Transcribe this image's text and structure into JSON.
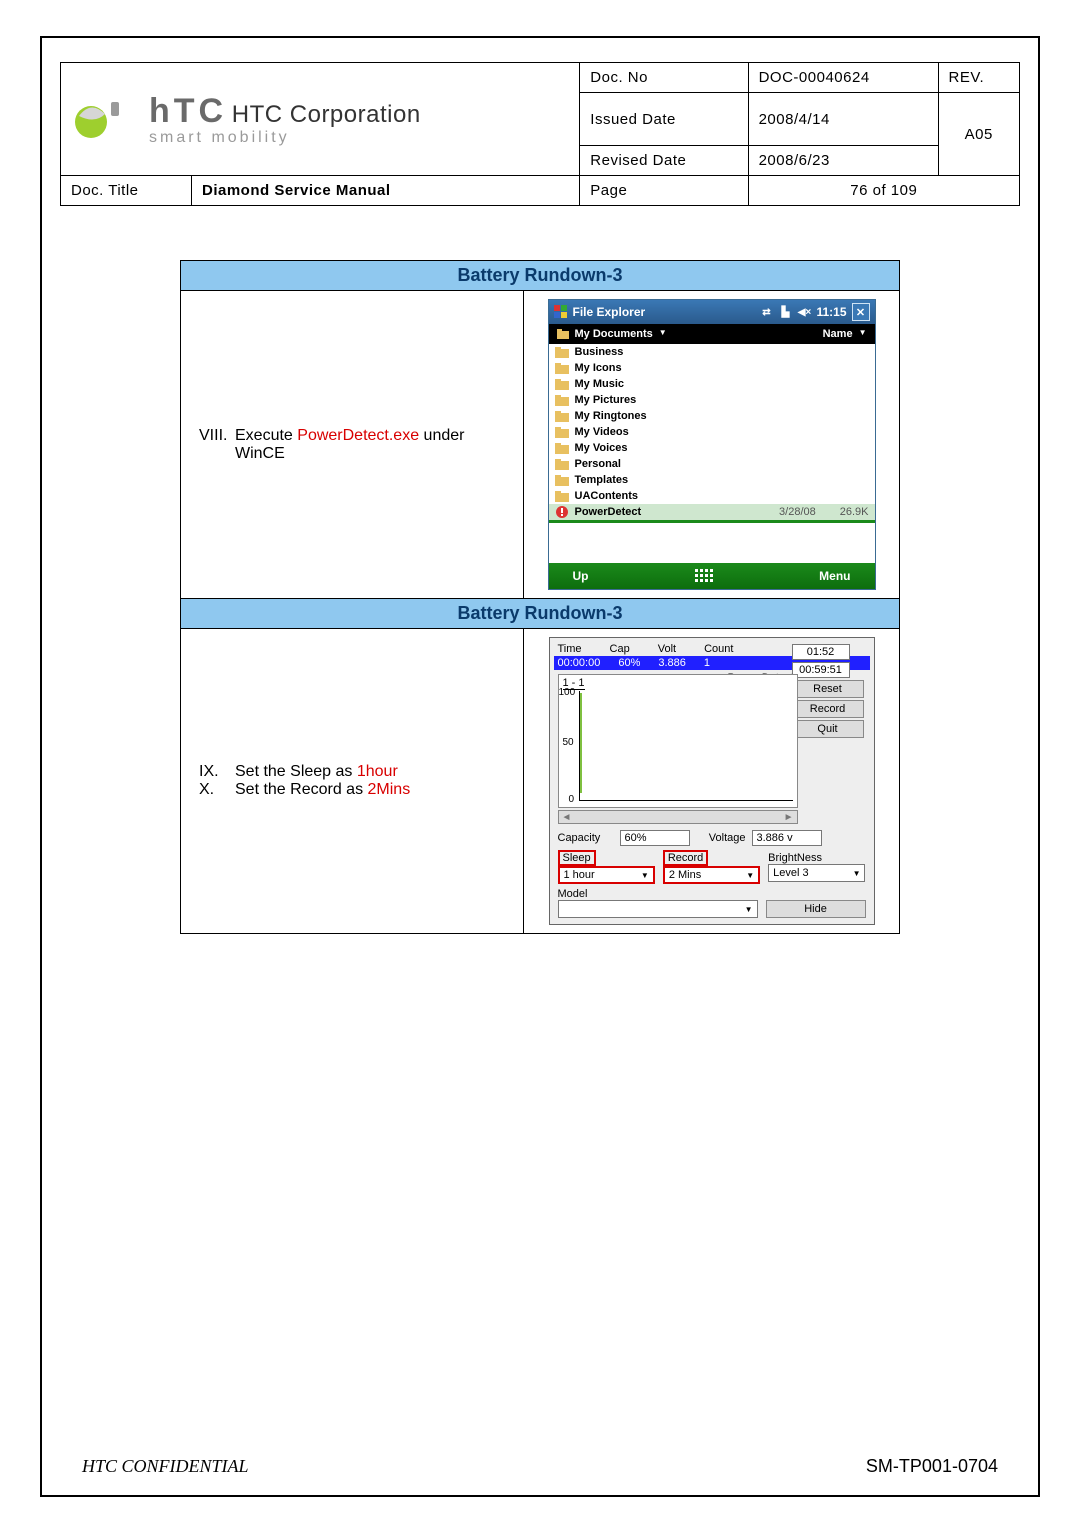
{
  "header": {
    "company": "HTC Corporation",
    "tagline": "smart mobility",
    "doc_no_label": "Doc. No",
    "doc_no": "DOC-00040624",
    "rev_label": "REV.",
    "rev": "A05",
    "issued_label": "Issued Date",
    "issued": "2008/4/14",
    "revised_label": "Revised Date",
    "revised": "2008/6/23",
    "doc_title_label": "Doc. Title",
    "doc_title": "Diamond Service Manual",
    "page_label": "Page",
    "page": "76  of  109"
  },
  "section1": {
    "title": "Battery Rundown-3",
    "instr_num": "VIII.",
    "instr_a": "Execute ",
    "instr_red": "PowerDetect.exe",
    "instr_b": " under",
    "instr_c": "WinCE"
  },
  "file_explorer": {
    "title": "File Explorer",
    "time": "11:15",
    "path": "My Documents",
    "sort": "Name",
    "items": [
      {
        "name": "Business",
        "type": "folder"
      },
      {
        "name": "My Icons",
        "type": "folder"
      },
      {
        "name": "My Music",
        "type": "folder"
      },
      {
        "name": "My Pictures",
        "type": "folder"
      },
      {
        "name": "My Ringtones",
        "type": "folder"
      },
      {
        "name": "My Videos",
        "type": "folder"
      },
      {
        "name": "My Voices",
        "type": "folder"
      },
      {
        "name": "Personal",
        "type": "folder"
      },
      {
        "name": "Templates",
        "type": "folder"
      },
      {
        "name": "UAContents",
        "type": "folder"
      }
    ],
    "selected": {
      "name": "PowerDetect",
      "date": "3/28/08",
      "size": "26.9K"
    },
    "btn_up": "Up",
    "btn_menu": "Menu"
  },
  "section2": {
    "title": "Battery Rundown-3",
    "line1_num": "IX.",
    "line1_a": "Set the Sleep as ",
    "line1_red": "1hour",
    "line2_num": "X.",
    "line2_a": "Set the Record as ",
    "line2_red": "2Mins"
  },
  "power_detect": {
    "hdr_time": "Time",
    "hdr_cap": "Cap",
    "hdr_volt": "Volt",
    "hdr_count": "Count",
    "row_time": "00:00:00",
    "row_cap": "60%",
    "row_volt": "3.886",
    "row_count": "1",
    "clock1": "01:52",
    "clock2": "00:59:51",
    "btn_reset": "Reset",
    "btn_record": "Record",
    "btn_quit": "Quit",
    "chart_title": "Power Detect",
    "chart_range": "1 - 1",
    "y100": "100",
    "y50": "50",
    "y0": "0",
    "capacity_label": "Capacity",
    "capacity": "60%",
    "voltage_label": "Voltage",
    "voltage": "3.886 v",
    "sleep_label": "Sleep",
    "sleep": "1 hour",
    "record_label": "Record",
    "record": "2 Mins",
    "bright_label": "BrightNess",
    "bright": "Level 3",
    "model_label": "Model",
    "model": "",
    "hide": "Hide"
  },
  "footer": {
    "confidential": "HTC CONFIDENTIAL",
    "code": "SM-TP001-0704"
  }
}
